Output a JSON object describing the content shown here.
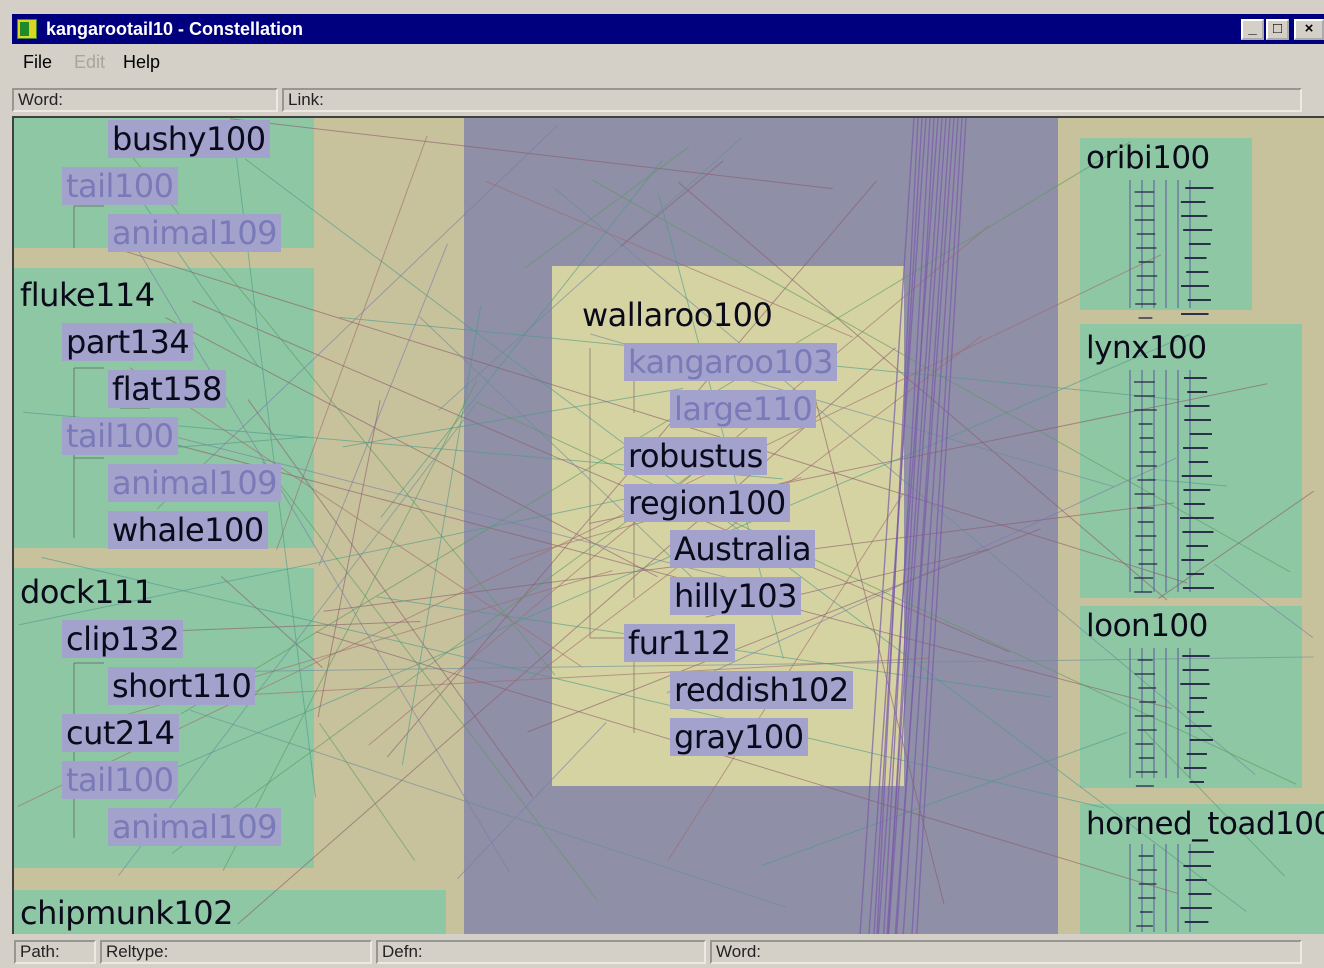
{
  "window": {
    "title": "kangarootail10 - Constellation",
    "minimize_glyph": "_",
    "maximize_glyph": "□",
    "close_glyph": "×"
  },
  "menu": {
    "file": "File",
    "edit": "Edit",
    "help": "Help"
  },
  "fields": {
    "word": "Word:",
    "link": "Link:"
  },
  "left_group": {
    "nodes": [
      "bushy100",
      "tail100",
      "animal109",
      "fluke114",
      "part134",
      "flat158",
      "tail100",
      "animal109",
      "whale100",
      "dock111",
      "clip132",
      "short110",
      "cut214",
      "tail100",
      "animal109",
      "chipmunk102"
    ]
  },
  "center_group": {
    "nodes": [
      "wallaroo100",
      "kangaroo103",
      "large110",
      "robustus",
      "region100",
      "Australia",
      "hilly103",
      "fur112",
      "reddish102",
      "gray100"
    ]
  },
  "right_group": {
    "labels": [
      "oribi100",
      "lynx100",
      "loon100",
      "horned_toad100"
    ]
  },
  "status": {
    "path": "Path:",
    "reltype": "Reltype:",
    "defn": "Defn:",
    "word": "Word:"
  },
  "colors": {
    "title_bar": "#00007e",
    "canvas_bg": "#c7c29c",
    "green_block": "#8ec7a4",
    "center_band": "#8f8fa8",
    "center_panel": "#d6d3a2",
    "node_highlight": "#a2a2cc"
  }
}
